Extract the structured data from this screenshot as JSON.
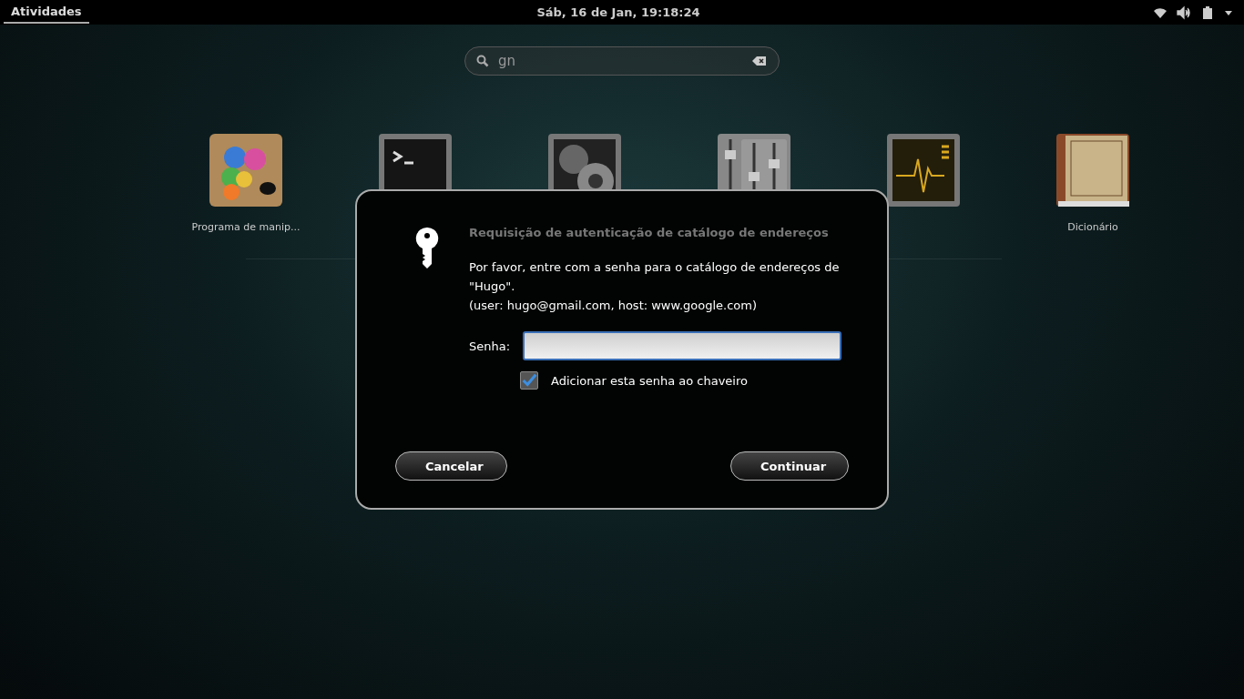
{
  "top_bar": {
    "activities": {
      "label": "Atividades",
      "selected": true
    },
    "clock": "Sáb, 16 de Jan, 19:18:24"
  },
  "search": {
    "value": "gn"
  },
  "apps": [
    {
      "label": "Programa de manip...",
      "kind": "paint"
    },
    {
      "kind": "terminal"
    },
    {
      "kind": "settings"
    },
    {
      "kind": "tweak"
    },
    {
      "kind": "monitor"
    },
    {
      "label": "Dicionário",
      "kind": "dictionary"
    }
  ],
  "dialog": {
    "title": "Requisição de autenticação de catálogo de endereços",
    "message": "Por favor, entre com a senha para o catálogo de endereços de \"Hugo\".",
    "details": "(user: hugo@gmail.com, host: www.google.com)",
    "password_label": "Senha:",
    "remember": {
      "label": "Adicionar esta senha ao chaveiro",
      "checked": true
    },
    "buttons": [
      {
        "label": "Cancelar"
      },
      {
        "label": "Continuar"
      }
    ]
  }
}
